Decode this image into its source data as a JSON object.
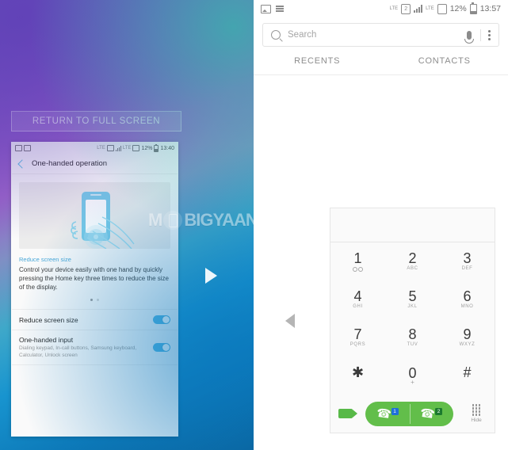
{
  "left_panel": {
    "full_screen_button": "RETURN TO FULL SCREEN",
    "mini_phone": {
      "status_bar": {
        "battery": "12%",
        "time": "13:40",
        "network": "LTE"
      },
      "app_title": "One-handed operation",
      "back_icon": "back-chevron-icon",
      "hero_caption": "Reduce screen size",
      "hero_body": "Control your device easily with one hand by quickly pressing the Home key three times to reduce the size of the display.",
      "rows": [
        {
          "title": "Reduce screen size",
          "subtitle": "",
          "toggle": "on"
        },
        {
          "title": "One-handed input",
          "subtitle": "Dialing keypad, In-call buttons, Samsung keyboard, Calculator, Unlock screen",
          "toggle": "on"
        }
      ]
    }
  },
  "right_panel": {
    "status_bar": {
      "battery": "12%",
      "time": "13:57",
      "network": "LTE"
    },
    "search": {
      "placeholder": "Search",
      "value": ""
    },
    "tabs": [
      {
        "label": "RECENTS",
        "active": false
      },
      {
        "label": "CONTACTS",
        "active": false
      }
    ],
    "dialpad": {
      "display_value": "",
      "keys": [
        {
          "num": "1",
          "sub": "",
          "sub_icon": "voicemail-icon"
        },
        {
          "num": "2",
          "sub": "ABC",
          "sub_icon": ""
        },
        {
          "num": "3",
          "sub": "DEF",
          "sub_icon": ""
        },
        {
          "num": "4",
          "sub": "GHI",
          "sub_icon": ""
        },
        {
          "num": "5",
          "sub": "JKL",
          "sub_icon": ""
        },
        {
          "num": "6",
          "sub": "MNO",
          "sub_icon": ""
        },
        {
          "num": "7",
          "sub": "PQRS",
          "sub_icon": ""
        },
        {
          "num": "8",
          "sub": "TUV",
          "sub_icon": ""
        },
        {
          "num": "9",
          "sub": "WXYZ",
          "sub_icon": ""
        },
        {
          "num": "✱",
          "sub": "",
          "sub_icon": ""
        },
        {
          "num": "0",
          "sub": "+",
          "sub_icon": ""
        },
        {
          "num": "#",
          "sub": "",
          "sub_icon": ""
        }
      ],
      "video_call_label": "video-call",
      "call_sim1_label": "1",
      "call_sim2_label": "2",
      "hide_label": "Hide"
    }
  },
  "overlays": {
    "next_arrow": "play-arrow",
    "prev_arrow": "left-arrow",
    "watermark": {
      "text_left": "M",
      "text_right": "BIGYAAN"
    }
  },
  "colors": {
    "gradient_purple": "#7a52c4",
    "gradient_teal": "#38b2ac",
    "gradient_blue": "#0a5f96",
    "accent_blue": "#55b7e3",
    "call_green": "#62be4a",
    "sim1_badge": "#1e6fd9",
    "sim2_badge": "#1b7a2e"
  }
}
